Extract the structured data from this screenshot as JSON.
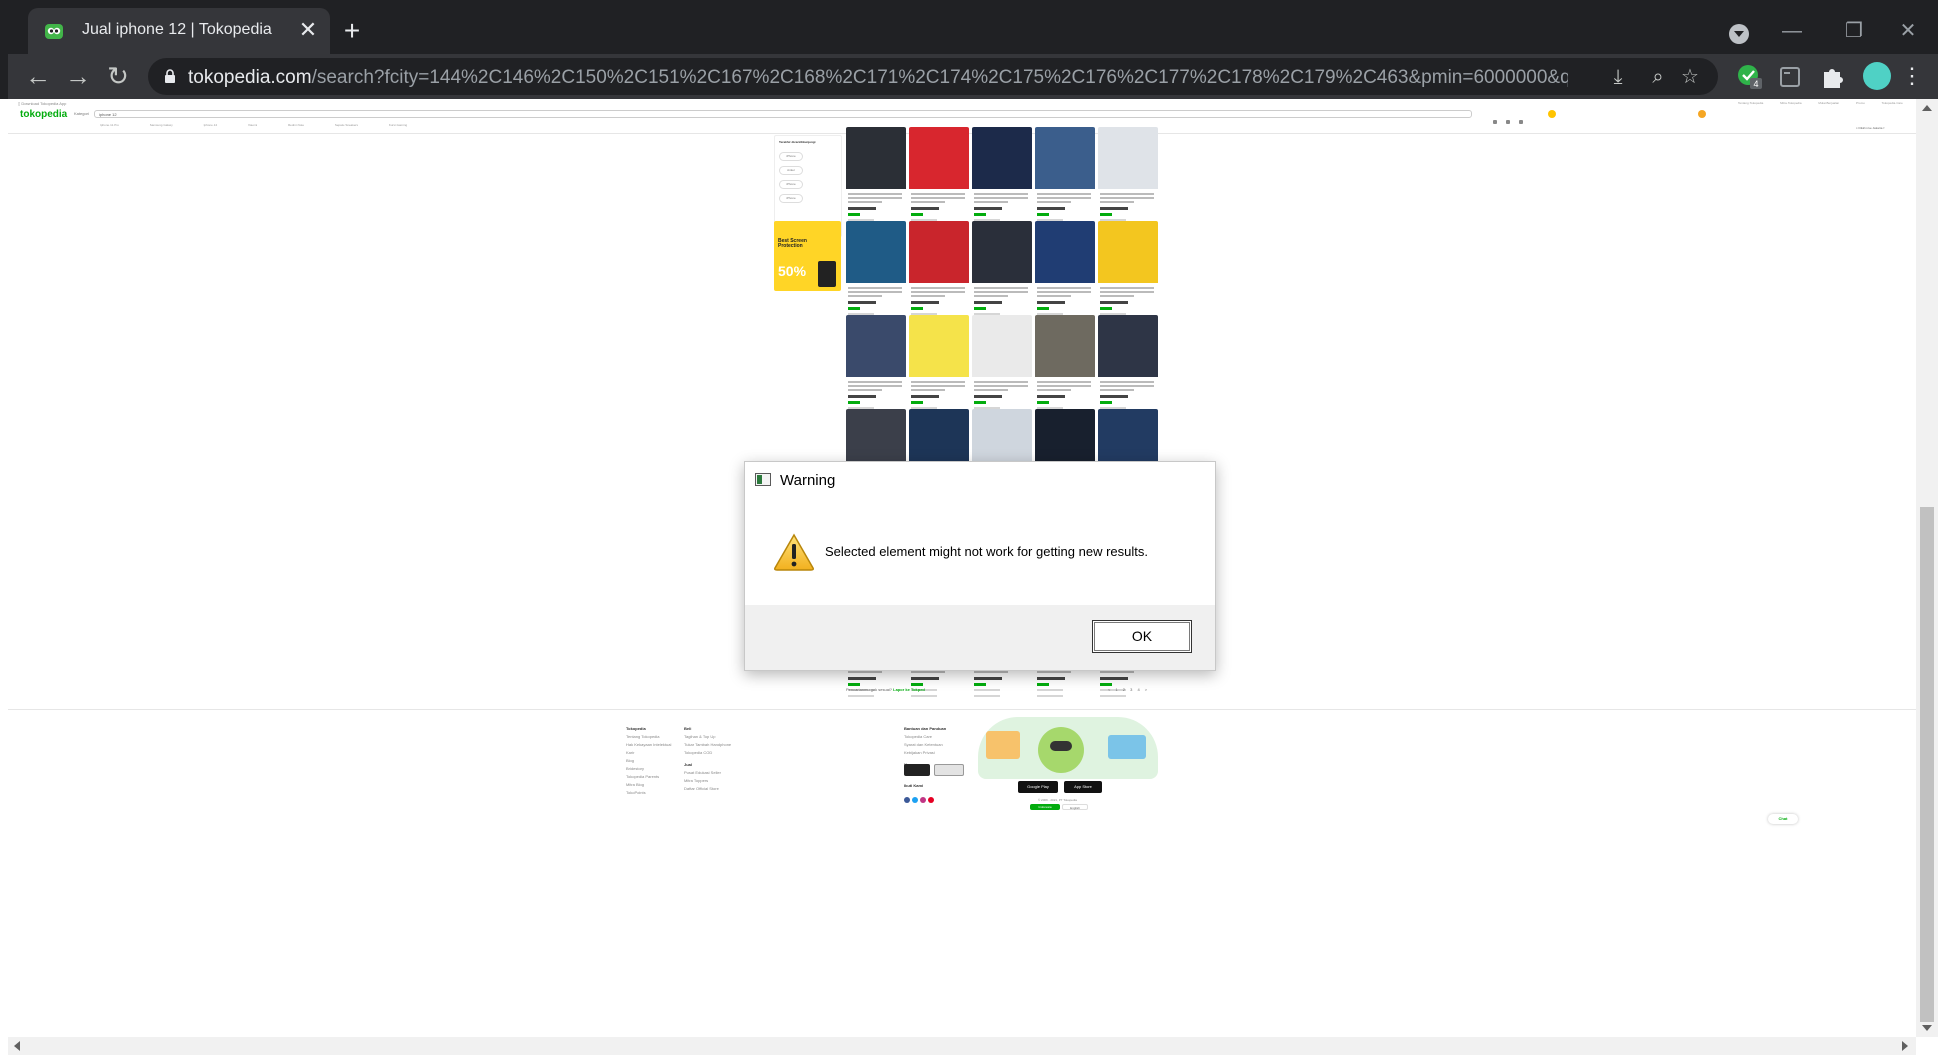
{
  "browser": {
    "tab_title": "Jual iphone 12 | Tokopedia",
    "url_host": "tokopedia.com",
    "url_path": "/search?fcity=144%2C146%2C150%2C151%2C167%2C168%2C171%2C174%2C175%2C176%2C177%2C178%2C179%2C463&pmin=6000000&q=iphone%2012&rt=...",
    "extension_badge": "4",
    "colors": {
      "frame": "#202124",
      "toolbar": "#35363a",
      "profile": "#4fd1c5"
    }
  },
  "page": {
    "brand": "tokopedia",
    "search_query": "iphone 12",
    "brand_color": "#03ac0e",
    "filter_title": "Terakhir dicari/dikunjungi",
    "promo_text": "Best Screen Protection",
    "promo_big": "50%",
    "feedback_text": "Pencarianmu gak sesuai?",
    "feedback_link": "Lapor ke Tokped",
    "pager": "< 1 2 3 4 >",
    "footer": {
      "col1": {
        "title": "Tokopedia",
        "items": [
          "Tentang Tokopedia",
          "Hak Kekayaan Intelektual",
          "Karir",
          "Blog",
          "Bridestory",
          "Tokopedia Parents",
          "Mitra Blog",
          "TokoPoints"
        ]
      },
      "col2": {
        "title": "Beli",
        "items": [
          "Tagihan & Top Up",
          "Tukar Tambah Handphone",
          "Tokopedia COD"
        ],
        "title2": "Jual",
        "items2": [
          "Pusat Edukasi Seller",
          "Mitra Toppers",
          "Daftar Official Store"
        ]
      },
      "col3": {
        "title": "Bantuan dan Panduan",
        "items": [
          "Tokopedia Care",
          "Syarat dan Ketentuan",
          "Kebijakan Privasi"
        ],
        "title2": "Keamanan",
        "title3": "Ikuti Kami"
      },
      "google_play": "Google Play",
      "app_store": "App Store",
      "copyright": "© 2009 - 2021, PT Tokopedia",
      "lang_id": "Indonesia",
      "lang_en": "English",
      "chat": "Chat"
    }
  },
  "dialog": {
    "title": "Warning",
    "message": "Selected element might not work for getting new results.",
    "ok_label": "OK",
    "icon": "warning-triangle-icon"
  }
}
